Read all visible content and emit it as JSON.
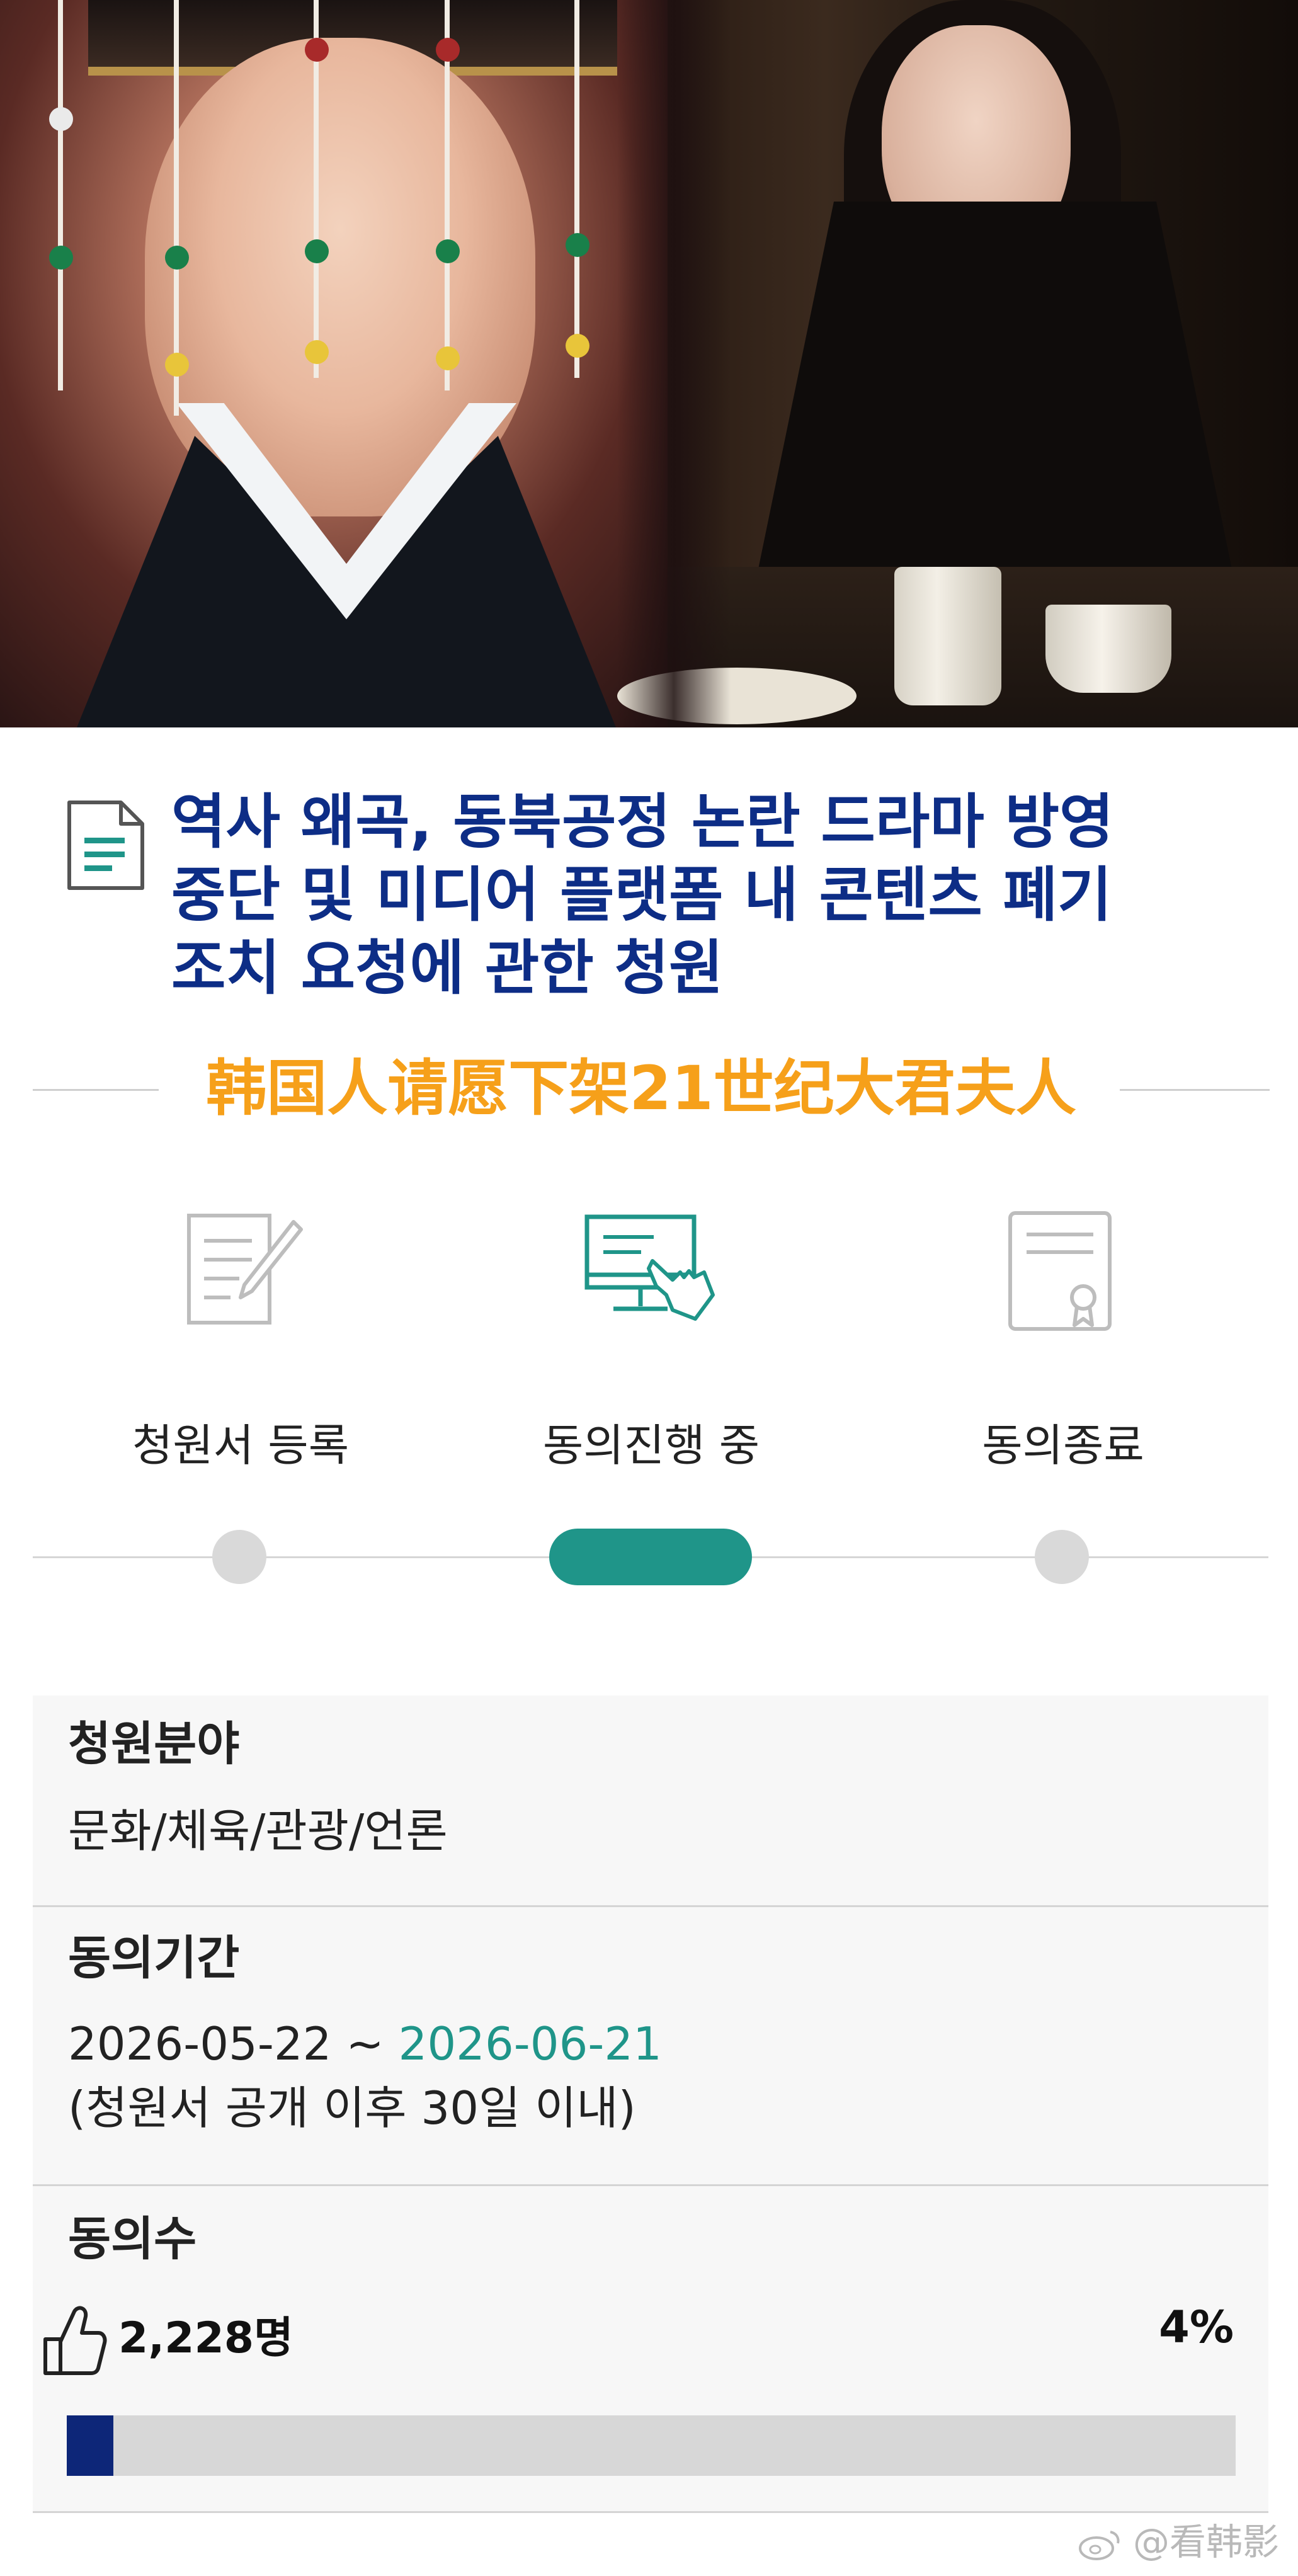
{
  "title": {
    "line1": "역사 왜곡, 동북공정 논란 드라마 방영",
    "line2": "중단 및 미디어 플랫폼 내 콘텐츠 폐기",
    "line3": "조치 요청에 관한 청원"
  },
  "overlay_caption": "韩国人请愿下架21世纪大君夫人",
  "steps": [
    {
      "label": "청원서 등록",
      "icon": "document-pen-icon",
      "active": false
    },
    {
      "label": "동의진행 중",
      "icon": "monitor-hand-icon",
      "active": true
    },
    {
      "label": "동의종료",
      "icon": "certificate-icon",
      "active": false
    }
  ],
  "info": {
    "field": {
      "heading": "청원분야",
      "value": "문화/체육/관광/언론"
    },
    "period": {
      "heading": "동의기간",
      "start": "2026-05-22",
      "separator": " ~ ",
      "end": "2026-06-21",
      "note": "(청원서 공개 이후 30일 이내)"
    },
    "agree": {
      "heading": "동의수",
      "count": "2,228명",
      "percent_label": "4%",
      "progress_fraction": 0.04
    }
  },
  "watermark": "@看韩影",
  "colors": {
    "title": "#0d2d86",
    "accent_teal": "#1f9589",
    "caption_orange": "#f6a01a",
    "progress_fill": "#0d2678"
  }
}
